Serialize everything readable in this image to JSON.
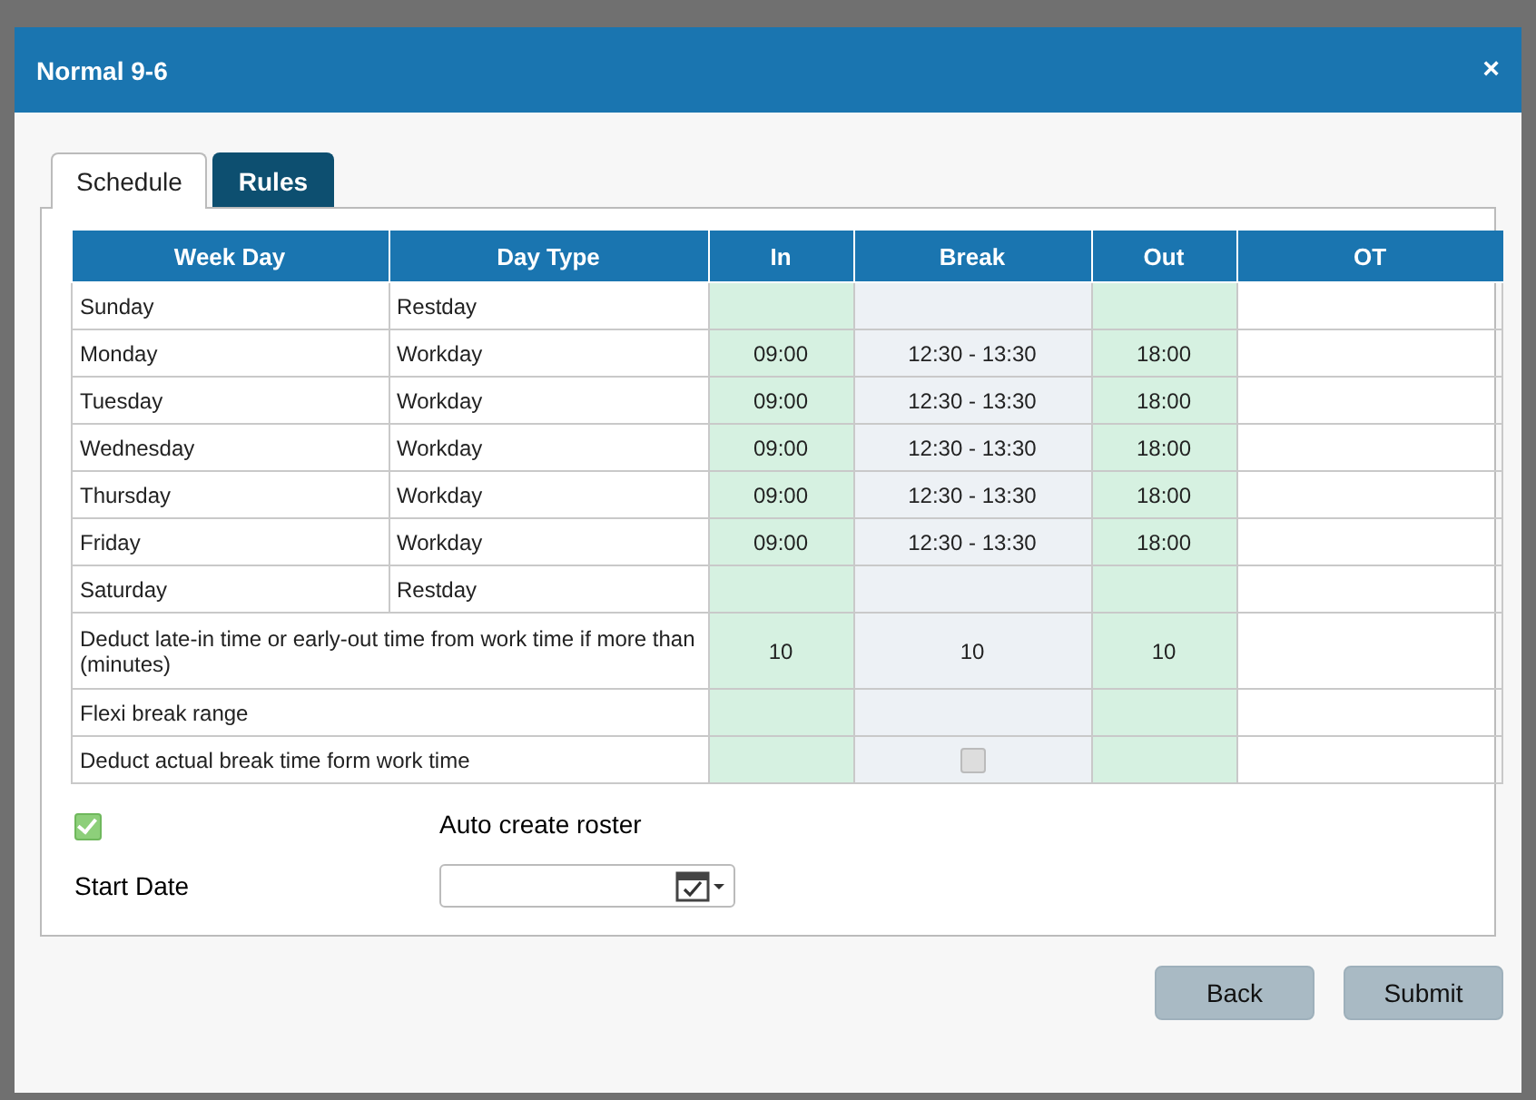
{
  "dialog": {
    "title": "Normal 9-6",
    "close_icon": "×"
  },
  "tabs": [
    {
      "label": "Schedule",
      "selected": true
    },
    {
      "label": "Rules",
      "selected": false
    }
  ],
  "table": {
    "columns": [
      "Week Day",
      "Day Type",
      "In",
      "Break",
      "Out",
      "OT"
    ],
    "rows": [
      {
        "kind": "day",
        "week_day": "Sunday",
        "day_type": "Restday"
      },
      {
        "kind": "day",
        "week_day": "Monday",
        "day_type": "Workday",
        "in": "09:00",
        "break": "12:30 - 13:30",
        "out": "18:00"
      },
      {
        "kind": "day",
        "week_day": "Tuesday",
        "day_type": "Workday",
        "in": "09:00",
        "break": "12:30 - 13:30",
        "out": "18:00"
      },
      {
        "kind": "day",
        "week_day": "Wednesday",
        "day_type": "Workday",
        "in": "09:00",
        "break": "12:30 - 13:30",
        "out": "18:00"
      },
      {
        "kind": "day",
        "week_day": "Thursday",
        "day_type": "Workday",
        "in": "09:00",
        "break": "12:30 - 13:30",
        "out": "18:00"
      },
      {
        "kind": "day",
        "week_day": "Friday",
        "day_type": "Workday",
        "in": "09:00",
        "break": "12:30 - 13:30",
        "out": "18:00"
      },
      {
        "kind": "day",
        "week_day": "Saturday",
        "day_type": "Restday"
      },
      {
        "kind": "setting",
        "label": "Deduct late-in time or early-out time from work time if more than (minutes)",
        "in": "10",
        "break": "10",
        "out": "10"
      },
      {
        "kind": "setting",
        "label": "Flexi break range"
      },
      {
        "kind": "setting",
        "label": "Deduct actual break time form work time",
        "break_checkbox": {
          "checked": false,
          "disabled": true
        }
      }
    ]
  },
  "auto_create_roster": {
    "checked": true,
    "label": "Auto create roster"
  },
  "start_date": {
    "label": "Start Date"
  },
  "buttons": [
    "Back",
    "Submit"
  ]
}
